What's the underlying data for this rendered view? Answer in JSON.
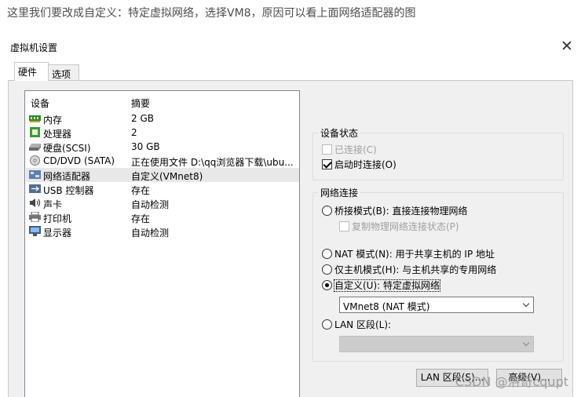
{
  "caption": "这里我们要改成自定义：特定虚拟网络，选择VM8，原因可以看上面网络适配器的图",
  "dialog": {
    "title": "虚拟机设置",
    "close_glyph": "✕",
    "tabs": [
      {
        "label": "硬件",
        "active": true
      },
      {
        "label": "选项",
        "active": false
      }
    ]
  },
  "devices": {
    "header_device": "设备",
    "header_summary": "摘要",
    "items": [
      {
        "name": "内存",
        "summary": "2 GB",
        "icon": "memory-icon"
      },
      {
        "name": "处理器",
        "summary": "2",
        "icon": "cpu-icon"
      },
      {
        "name": "硬盘(SCSI)",
        "summary": "30 GB",
        "icon": "hard-disk-icon"
      },
      {
        "name": "CD/DVD (SATA)",
        "summary": "正在使用文件 D:\\qq浏览器下载\\ubu...",
        "icon": "cd-dvd-icon"
      },
      {
        "name": "网络适配器",
        "summary": "自定义(VMnet8)",
        "icon": "network-adapter-icon",
        "selected": true
      },
      {
        "name": "USB 控制器",
        "summary": "存在",
        "icon": "usb-icon"
      },
      {
        "name": "声卡",
        "summary": "自动检测",
        "icon": "sound-card-icon"
      },
      {
        "name": "打印机",
        "summary": "存在",
        "icon": "printer-icon"
      },
      {
        "name": "显示器",
        "summary": "自动检测",
        "icon": "display-icon"
      }
    ]
  },
  "device_status": {
    "legend": "设备状态",
    "connected": {
      "label": "已连接(C)",
      "checked": false,
      "disabled": true
    },
    "connect_at_power_on": {
      "label": "启动时连接(O)",
      "checked": true
    }
  },
  "network": {
    "legend": "网络连接",
    "bridged": {
      "label": "桥接模式(B): 直接连接物理网络",
      "selected": false
    },
    "replicate": {
      "label": "复制物理网络连接状态(P)",
      "checked": false,
      "disabled": true
    },
    "nat": {
      "label": "NAT 模式(N): 用于共享主机的 IP 地址",
      "selected": false
    },
    "host_only": {
      "label": "仅主机模式(H): 与主机共享的专用网络",
      "selected": false
    },
    "custom": {
      "label": "自定义(U): 特定虚拟网络",
      "selected": true
    },
    "custom_select_value": "VMnet8 (NAT 模式)",
    "lan_segment": {
      "label": "LAN 区段(L):",
      "selected": false
    },
    "lan_select_value": ""
  },
  "buttons": {
    "lan_segments": "LAN 区段(S)...",
    "advanced": "高级(V)..."
  },
  "watermark": "CSDN @洛奇cqupt"
}
